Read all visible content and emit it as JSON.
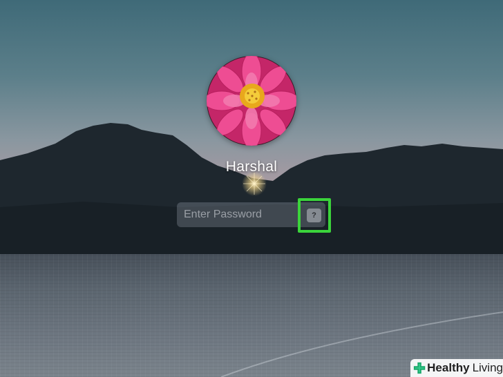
{
  "login": {
    "username": "Harshal",
    "password_placeholder": "Enter Password",
    "hint_button_label": "?"
  },
  "colors": {
    "highlight": "#3bd43b",
    "avatar_flower": "#e0307a"
  },
  "icons": {
    "avatar": "pink-flower-avatar-icon",
    "hint": "question-mark-icon",
    "watermark": "green-cross-icon"
  },
  "watermark": {
    "word1": "Healthy",
    "word2": "Living"
  }
}
